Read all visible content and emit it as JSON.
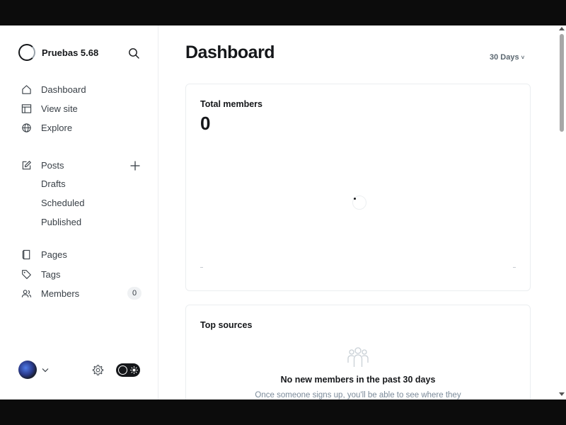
{
  "site": {
    "name": "Pruebas 5.68"
  },
  "nav": {
    "dashboard": "Dashboard",
    "view_site": "View site",
    "explore": "Explore",
    "posts": "Posts",
    "drafts": "Drafts",
    "scheduled": "Scheduled",
    "published": "Published",
    "pages": "Pages",
    "tags": "Tags",
    "members": "Members",
    "members_count": "0"
  },
  "header": {
    "title": "Dashboard",
    "range": "30 Days",
    "range_chevron": "˅"
  },
  "total_members": {
    "title": "Total members",
    "value": "0"
  },
  "top_sources": {
    "title": "Top sources",
    "empty_title": "No new members in the past 30 days",
    "empty_desc": "Once someone signs up, you'll be able to see where they"
  },
  "icons": {
    "logo": "site-logo-icon",
    "search": "search-icon",
    "home": "home-icon",
    "view_site": "layout-icon",
    "explore": "globe-icon",
    "posts": "edit-icon",
    "add": "plus-icon",
    "pages": "pages-icon",
    "tags": "tag-icon",
    "members": "members-icon",
    "settings": "gear-icon",
    "theme": "sun-icon",
    "empty": "people-icon"
  },
  "colors": {
    "text": "#15171a",
    "muted": "#7c8b9a",
    "border": "#ebeef0",
    "frame": "#0c0c0c"
  }
}
